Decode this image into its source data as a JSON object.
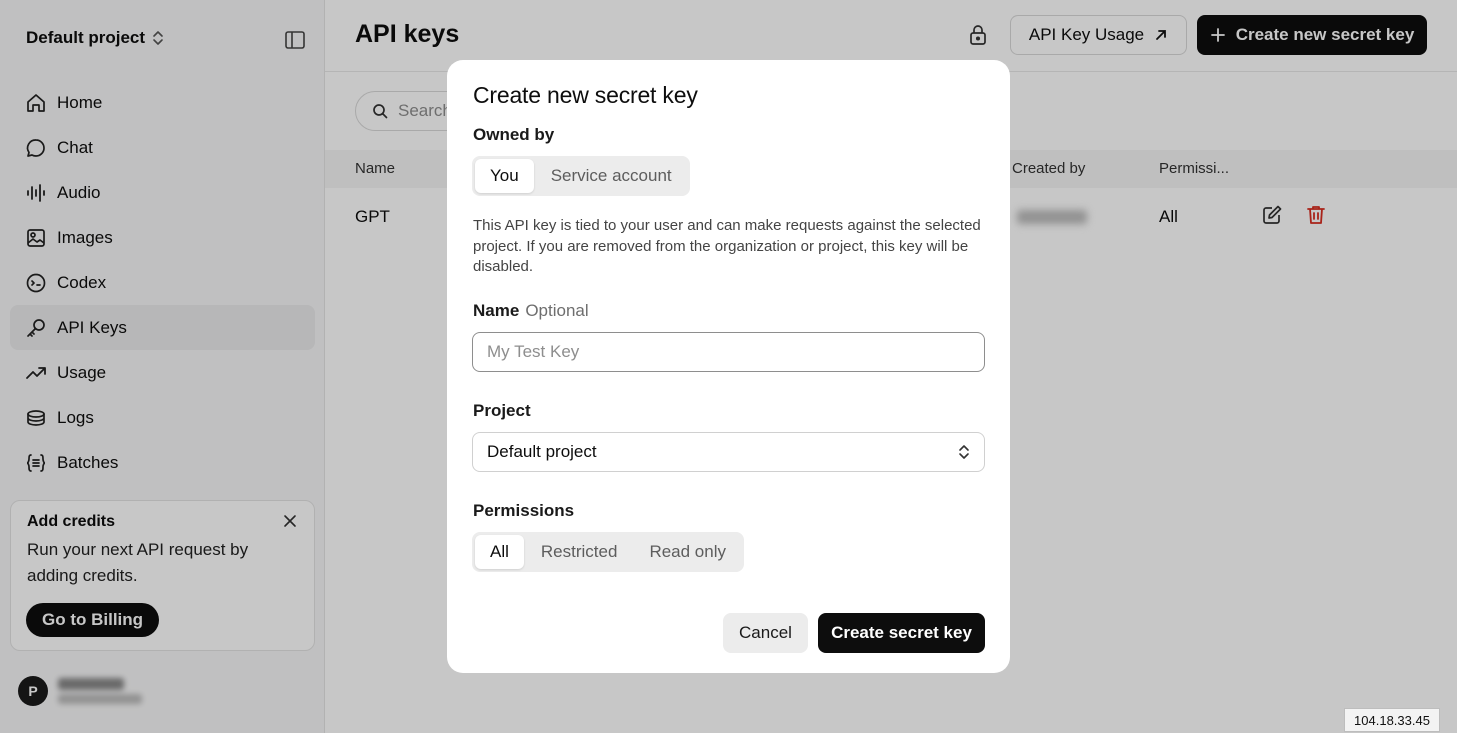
{
  "sidebar": {
    "project_name": "Default project",
    "items": [
      {
        "label": "Home",
        "icon": "home-icon"
      },
      {
        "label": "Chat",
        "icon": "chat-icon"
      },
      {
        "label": "Audio",
        "icon": "audio-icon"
      },
      {
        "label": "Images",
        "icon": "images-icon"
      },
      {
        "label": "Codex",
        "icon": "codex-icon"
      },
      {
        "label": "API Keys",
        "icon": "key-icon",
        "active": true
      },
      {
        "label": "Usage",
        "icon": "usage-icon"
      },
      {
        "label": "Logs",
        "icon": "logs-icon"
      },
      {
        "label": "Batches",
        "icon": "batches-icon"
      }
    ],
    "credits": {
      "title": "Add credits",
      "text": "Run your next API request by adding credits.",
      "button": "Go to Billing"
    },
    "user": {
      "initial": "P"
    }
  },
  "header": {
    "title": "API keys",
    "usage_button": "API Key Usage",
    "create_button": "Create new secret key"
  },
  "search": {
    "placeholder": "Search"
  },
  "table": {
    "columns": {
      "name": "Name",
      "created_by": "Created by",
      "permissions": "Permissi..."
    },
    "rows": [
      {
        "name": "GPT",
        "permissions": "All"
      }
    ]
  },
  "modal": {
    "title": "Create new secret key",
    "owned_by_label": "Owned by",
    "owned_by_options": [
      "You",
      "Service account"
    ],
    "owned_by_selected": "You",
    "description": "This API key is tied to your user and can make requests against the selected project. If you are removed from the organization or project, this key will be disabled.",
    "name_label": "Name",
    "name_optional": "Optional",
    "name_placeholder": "My Test Key",
    "name_value": "",
    "project_label": "Project",
    "project_value": "Default project",
    "permissions_label": "Permissions",
    "permissions_options": [
      "All",
      "Restricted",
      "Read only"
    ],
    "permissions_selected": "All",
    "cancel_button": "Cancel",
    "submit_button": "Create secret key"
  },
  "ip_address": "104.18.33.45",
  "colors": {
    "primary": "#0d0d0d",
    "danger": "#d92d20",
    "sidebar_bg": "#f7f7f8",
    "overlay": "rgba(0,0,0,0.22)"
  }
}
